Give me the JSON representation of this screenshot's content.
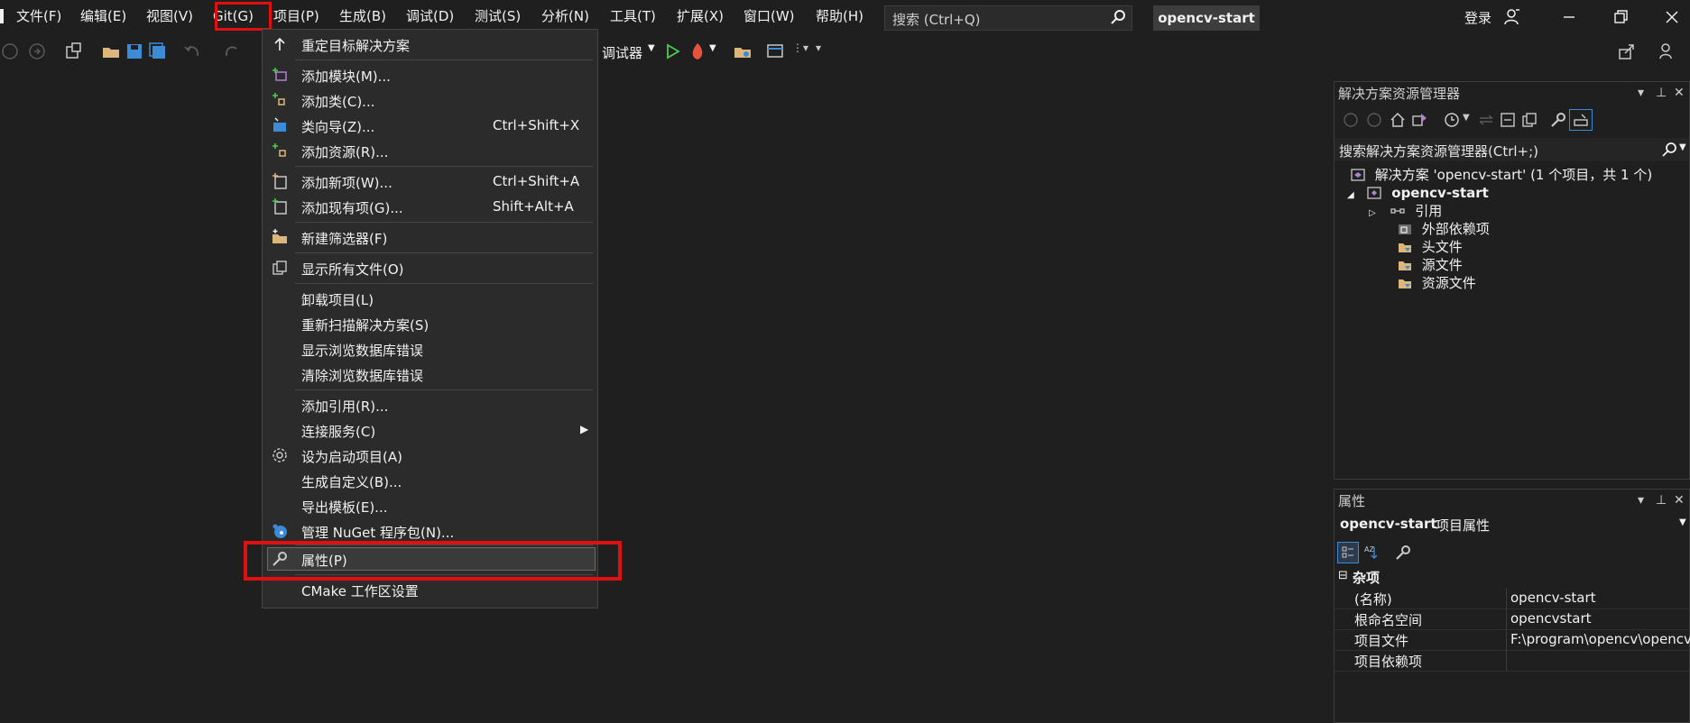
{
  "menubar": {
    "items": [
      "文件(F)",
      "编辑(E)",
      "视图(V)",
      "Git(G)",
      "项目(P)",
      "生成(B)",
      "调试(D)",
      "测试(S)",
      "分析(N)",
      "工具(T)",
      "扩展(X)",
      "窗口(W)",
      "帮助(H)"
    ],
    "search_placeholder": "搜索 (Ctrl+Q)",
    "solution_name": "opencv-start",
    "signin": "登录"
  },
  "toolbar": {
    "debugger_label": "调试器"
  },
  "project_menu": {
    "items": [
      {
        "label": "重定目标解决方案",
        "shortcut": "",
        "icon": "up-arrow-icon"
      },
      {
        "label": "添加模块(M)...",
        "shortcut": "",
        "icon": "add-module-icon"
      },
      {
        "label": "添加类(C)...",
        "shortcut": "",
        "icon": "add-class-icon"
      },
      {
        "label": "类向导(Z)...",
        "shortcut": "Ctrl+Shift+X",
        "icon": "class-wizard-icon"
      },
      {
        "label": "添加资源(R)...",
        "shortcut": "",
        "icon": "add-resource-icon"
      },
      {
        "label": "添加新项(W)...",
        "shortcut": "Ctrl+Shift+A",
        "icon": "add-new-item-icon"
      },
      {
        "label": "添加现有项(G)...",
        "shortcut": "Shift+Alt+A",
        "icon": "add-existing-item-icon"
      },
      {
        "label": "新建筛选器(F)",
        "shortcut": "",
        "icon": "new-filter-icon"
      },
      {
        "label": "显示所有文件(O)",
        "shortcut": "",
        "icon": "show-all-files-icon"
      },
      {
        "label": "卸载项目(L)",
        "shortcut": "",
        "icon": ""
      },
      {
        "label": "重新扫描解决方案(S)",
        "shortcut": "",
        "icon": ""
      },
      {
        "label": "显示浏览数据库错误",
        "shortcut": "",
        "icon": ""
      },
      {
        "label": "清除浏览数据库错误",
        "shortcut": "",
        "icon": ""
      },
      {
        "label": "添加引用(R)...",
        "shortcut": "",
        "icon": ""
      },
      {
        "label": "连接服务(C)",
        "shortcut": "",
        "icon": ""
      },
      {
        "label": "设为启动项目(A)",
        "shortcut": "",
        "icon": "gear-icon"
      },
      {
        "label": "生成自定义(B)...",
        "shortcut": "",
        "icon": ""
      },
      {
        "label": "导出模板(E)...",
        "shortcut": "",
        "icon": ""
      },
      {
        "label": "管理 NuGet 程序包(N)...",
        "shortcut": "",
        "icon": "nuget-icon"
      },
      {
        "label": "属性(P)",
        "shortcut": "",
        "icon": "wrench-icon"
      },
      {
        "label": "CMake 工作区设置",
        "shortcut": "",
        "icon": ""
      }
    ]
  },
  "solution_explorer": {
    "title": "解决方案资源管理器",
    "search_placeholder": "搜索解决方案资源管理器(Ctrl+;)",
    "solution_row": "解决方案 'opencv-start' (1 个项目，共 1 个)",
    "project_row": "opencv-start",
    "tree": [
      "引用",
      "外部依赖项",
      "头文件",
      "源文件",
      "资源文件"
    ]
  },
  "properties": {
    "title": "属性",
    "header_name": "opencv-start",
    "header_desc": "项目属性",
    "category": "杂项",
    "rows": [
      {
        "name": "(名称)",
        "value": "opencv-start"
      },
      {
        "name": "根命名空间",
        "value": "opencvstart"
      },
      {
        "name": "项目文件",
        "value": "F:\\program\\opencv\\opencv"
      },
      {
        "name": "项目依赖项",
        "value": ""
      }
    ]
  },
  "colors": {
    "highlight_red": "#e01010",
    "background": "#1f1f1f",
    "menu_bg": "#2b2b2b"
  }
}
